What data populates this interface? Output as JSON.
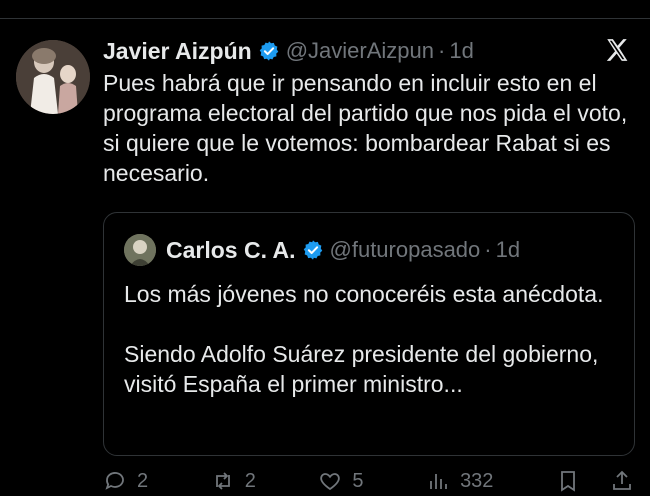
{
  "tweet": {
    "author_name": "Javier Aizpún",
    "handle": "@JavierAizpun",
    "separator": "·",
    "time": "1d",
    "text": "Pues habrá que ir pensando en incluir esto en el programa electoral del partido que nos pida el voto, si quiere que le votemos: bombardear Rabat si es necesario."
  },
  "quoted_tweet": {
    "author_name": "Carlos C. A.",
    "handle": "@futuropasado",
    "separator": "·",
    "time": "1d",
    "text": "Los más jóvenes no conoceréis esta anécdota.\n\nSiendo Adolfo Suárez presidente del gobierno, visitó España el primer ministro..."
  },
  "actions": {
    "replies": "2",
    "reposts": "2",
    "likes": "5",
    "views": "332"
  },
  "colors": {
    "background": "#000000",
    "text": "#e7e9ea",
    "muted": "#71767b",
    "verified": "#1d9bf0",
    "border": "#2f3336"
  },
  "icons": [
    "verified-badge-icon",
    "x-logo-icon",
    "reply-icon",
    "repost-icon",
    "like-icon",
    "views-icon",
    "bookmark-icon",
    "share-icon"
  ]
}
